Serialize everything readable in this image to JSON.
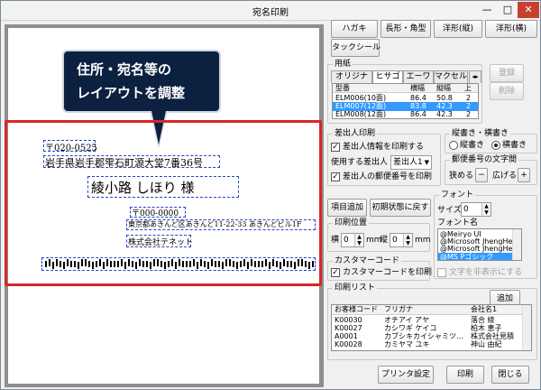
{
  "window": {
    "title": "宛名印刷",
    "min": "—",
    "max": "□",
    "close": "✕"
  },
  "preview": {
    "postal_code": "〒020-0525",
    "address": "岩手県岩手郡雫石町源大堂7番36号",
    "recipient": "綾小路 しほり 様",
    "sender_postal": "〒000-0000",
    "sender_address": "東京都あきんど区あきんど11-22-33 あきんどビル1F",
    "sender_company": "株式会社テネット"
  },
  "callout": {
    "line1": "住所・宛名等の",
    "line2": "レイアウトを調整"
  },
  "toolbar": {
    "hagaki": "ハガキ",
    "choukei": "長形・角型",
    "youkei_tate": "洋形(縦)",
    "youkei_yoko": "洋形(横)",
    "tack_seal": "タックシール"
  },
  "paper": {
    "group_label": "用紙",
    "tabs": [
      "オリジナル",
      "ヒサゴ",
      "エーワン",
      "マクセル"
    ],
    "active_tab": 1,
    "tab_arrows": "◂▸",
    "columns": [
      "型番",
      "横幅",
      "縦幅",
      "上"
    ],
    "rows": [
      {
        "model": "ELM006(10面)",
        "w": "86.4",
        "h": "50.8",
        "t": "2"
      },
      {
        "model": "ELM007(12面)",
        "w": "83.8",
        "h": "42.3",
        "t": "2"
      },
      {
        "model": "ELM008(12面)",
        "w": "86.4",
        "h": "42.3",
        "t": "2"
      }
    ],
    "selected_row": 1,
    "register": "登録",
    "delete": "削除"
  },
  "sender": {
    "group_label": "差出人印刷",
    "print_sender": "差出人情報を印刷する",
    "use_label": "使用する差出人",
    "use_value": "差出人1",
    "print_postal": "差出人の郵便番号を印刷"
  },
  "orientation": {
    "group_label": "縦書き・横書き",
    "vertical": "縦書き",
    "horizontal": "横書き",
    "selected": "横書き"
  },
  "postal_spacing": {
    "group_label": "郵便番号の文字間",
    "narrow": "狭める",
    "minus": "−",
    "widen": "広げる",
    "plus": "+"
  },
  "actions": {
    "add_item": "項目追加",
    "reset": "初期状態に戻す"
  },
  "font": {
    "group_label": "フォント",
    "size_label": "サイズ",
    "size_value": "0",
    "name_label": "フォント名",
    "options": [
      "@Meiryo UI",
      "@Microsoft JhengHe",
      "@Microsoft JhengHe",
      "@MS Pゴシック"
    ],
    "selected": 3,
    "hide_char": "文字を非表示にする"
  },
  "print_position": {
    "group_label": "印刷位置",
    "x_label": "横",
    "x_value": "0",
    "x_unit": "mm",
    "y_label": "縦",
    "y_value": "0",
    "y_unit": "mm"
  },
  "barcode": {
    "group_label": "カスタマーコード",
    "print": "カスタマーコードを印刷"
  },
  "print_list": {
    "group_label": "印刷リスト",
    "add": "追加",
    "columns": [
      "お客様コード",
      "フリガナ",
      "会社名1"
    ],
    "rows": [
      {
        "code": "K00030",
        "kana": "オチアイ アヤ",
        "company": "落合 綾"
      },
      {
        "code": "K00027",
        "kana": "カシワギ ケイコ",
        "company": "柏木 恵子"
      },
      {
        "code": "A0001",
        "kana": "カブシキカイシャミツ…",
        "company": "株式会社見積"
      },
      {
        "code": "K00028",
        "kana": "カミヤマ ユキ",
        "company": "神山 由紀"
      }
    ]
  },
  "footer": {
    "printer_settings": "プリンタ設定",
    "print": "印刷",
    "close": "閉じる"
  }
}
